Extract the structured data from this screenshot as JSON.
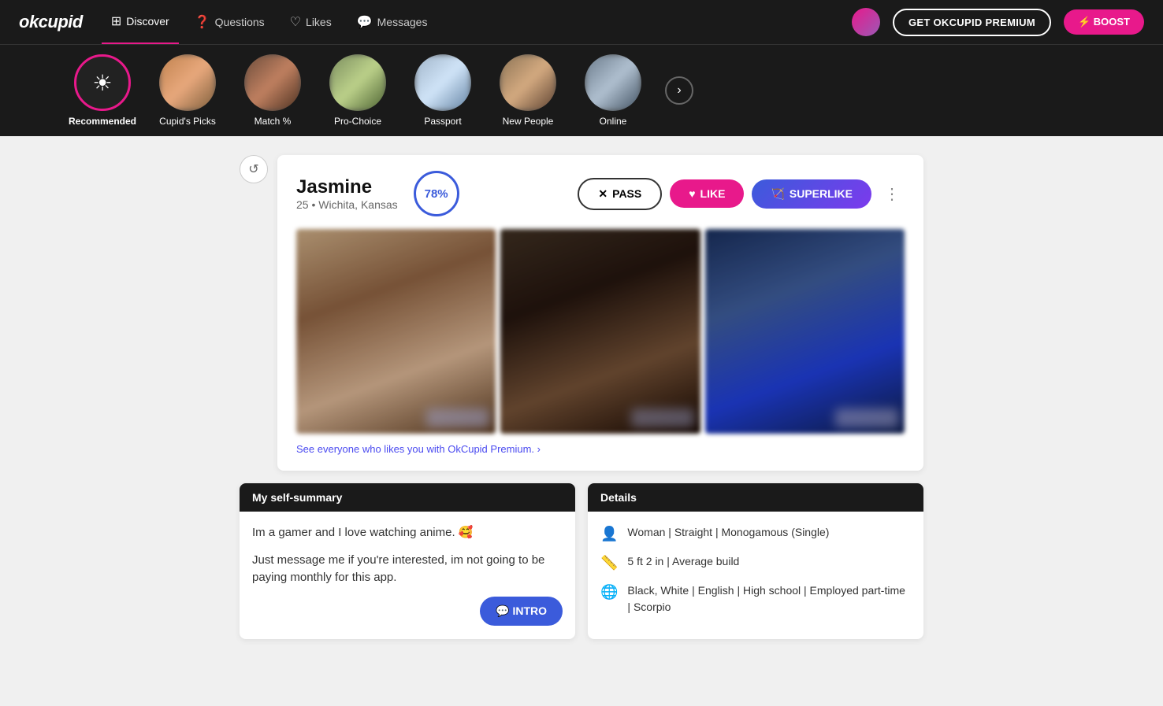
{
  "app": {
    "logo": "okcupid",
    "nav": [
      {
        "id": "discover",
        "label": "Discover",
        "icon": "⊞",
        "active": true
      },
      {
        "id": "questions",
        "label": "Questions",
        "icon": "❓"
      },
      {
        "id": "likes",
        "label": "Likes",
        "icon": "♡"
      },
      {
        "id": "messages",
        "label": "Messages",
        "icon": "💬"
      }
    ],
    "premium_btn": "GET OKCUPID PREMIUM",
    "boost_btn": "⚡ BOOST"
  },
  "discovery": {
    "items": [
      {
        "id": "recommended",
        "label": "Recommended",
        "active": true,
        "type": "icon"
      },
      {
        "id": "cupids-picks",
        "label": "Cupid's Picks",
        "type": "photo",
        "theme": "t2"
      },
      {
        "id": "match",
        "label": "Match %",
        "type": "photo",
        "theme": "t3"
      },
      {
        "id": "pro-choice",
        "label": "Pro-Choice",
        "type": "photo",
        "theme": "t4"
      },
      {
        "id": "passport",
        "label": "Passport",
        "type": "photo",
        "theme": "t5"
      },
      {
        "id": "new-people",
        "label": "New People",
        "type": "photo",
        "theme": "t6"
      },
      {
        "id": "online",
        "label": "Online",
        "type": "photo",
        "theme": "t7"
      }
    ],
    "next_label": "›"
  },
  "profile": {
    "undo_label": "↺",
    "name": "Jasmine",
    "age": "25",
    "location": "Wichita, Kansas",
    "match_pct": "78%",
    "actions": {
      "pass": "PASS",
      "like": "LIKE",
      "superlike": "SUPERLIKE"
    },
    "premium_prompt": "See everyone who likes you with OkCupid Premium. ›",
    "self_summary": {
      "header": "My self-summary",
      "para1": "Im a gamer and I love watching anime. 🥰",
      "para2": "Just message me if you're interested, im not going to be paying monthly for this app.",
      "intro_btn": "💬 INTRO"
    },
    "details": {
      "header": "Details",
      "rows": [
        {
          "icon": "👤",
          "text": "Woman | Straight | Monogamous (Single)"
        },
        {
          "icon": "📏",
          "text": "5 ft 2 in | Average build"
        },
        {
          "icon": "🌐",
          "text": "Black, White | English | High school | Employed part-time | Scorpio"
        }
      ]
    }
  }
}
